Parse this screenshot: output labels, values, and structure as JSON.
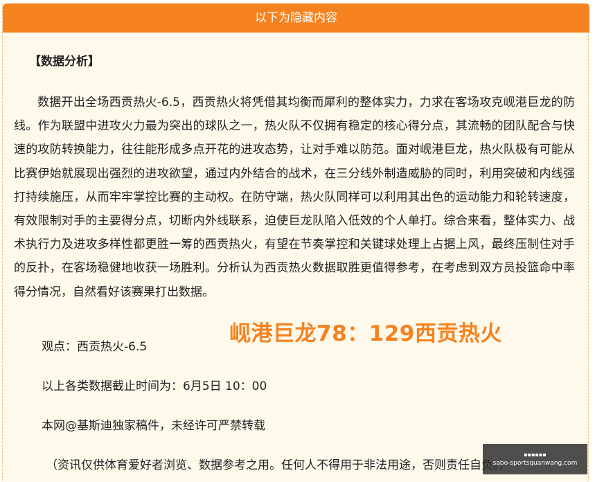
{
  "header": {
    "title": "以下为隐藏内容"
  },
  "article": {
    "section_title": "【数据分析】",
    "paragraph": "数据开出全场西贡热火-6.5，西贡热火将凭借其均衡而犀利的整体实力，力求在客场攻克岘港巨龙的防线。作为联盟中进攻火力最为突出的球队之一，热火队不仅拥有稳定的核心得分点，其流畅的团队配合与快速的攻防转换能力，往往能形成多点开花的进攻态势，让对手难以防范。面对岘港巨龙，热火队极有可能从比赛伊始就展现出强烈的进攻欲望，通过内外结合的战术，在三分线外制造威胁的同时，利用突破和内线强打持续施压，从而牢牢掌控比赛的主动权。在防守端，热火队同样可以利用其出色的运动能力和轮转速度，有效限制对手的主要得分点，切断内外线联系，迫使巨龙队陷入低效的个人单打。综合来看，整体实力、战术执行力及进攻多样性都更胜一筹的西贡热火，有望在节奏掌控和关键球处理上占据上风，最终压制住对手的反扑，在客场稳健地收获一场胜利。分析认为西贡热火数据取胜更值得参考，在考虑到双方员投篮命中率得分情况，自然看好该赛果打出数据。",
    "score_text": "岘港巨龙78：129西贡热火",
    "viewpoint": "观点：西贡热火-6.5",
    "deadline": "以上各类数据截止时间为：6月5日 10：00",
    "copyright": "本网@基斯迪独家稿件，未经许可严禁转载",
    "disclaimer": "（资讯仅供体育爱好者浏览、数据参考之用。任何人不得用于非法用途，否则责任自负。）"
  },
  "watermark": {
    "top_text": "▪▪▪▪▪▪",
    "url": "sabo-sportsquanwang.com"
  },
  "colors": {
    "accent": "#f5821f",
    "box_background": "#fff9ec",
    "box_border": "#f3c27a"
  }
}
